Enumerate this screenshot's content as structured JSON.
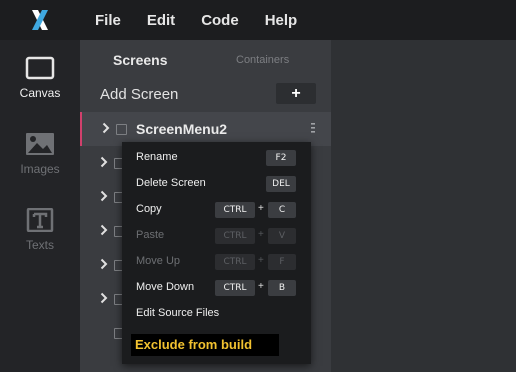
{
  "app": {
    "logo_letter": "X",
    "accent": "#d1406c",
    "highlight_text": "#f2c230"
  },
  "menu": [
    "File",
    "Edit",
    "Code",
    "Help"
  ],
  "rail": [
    {
      "label": "Canvas",
      "icon": "canvas-icon",
      "active": true
    },
    {
      "label": "Images",
      "icon": "image-icon",
      "active": false
    },
    {
      "label": "Texts",
      "icon": "text-icon",
      "active": false
    }
  ],
  "panel": {
    "tabs": {
      "screens": "Screens",
      "containers": "Containers"
    },
    "add_label": "Add Screen",
    "add_button": "+",
    "selected_screen": "ScreenMenu2"
  },
  "context_menu": {
    "rename": {
      "label": "Rename",
      "keys": [
        "F2"
      ]
    },
    "delete": {
      "label": "Delete Screen",
      "keys": [
        "DEL"
      ]
    },
    "copy": {
      "label": "Copy",
      "keys": [
        "CTRL",
        "C"
      ]
    },
    "paste": {
      "label": "Paste",
      "keys": [
        "CTRL",
        "V"
      ]
    },
    "move_up": {
      "label": "Move Up",
      "keys": [
        "CTRL",
        "F"
      ]
    },
    "move_down": {
      "label": "Move Down",
      "keys": [
        "CTRL",
        "B"
      ]
    },
    "edit_source": {
      "label": "Edit Source Files"
    },
    "exclude": {
      "label": "Exclude from build"
    },
    "plus": "+"
  }
}
